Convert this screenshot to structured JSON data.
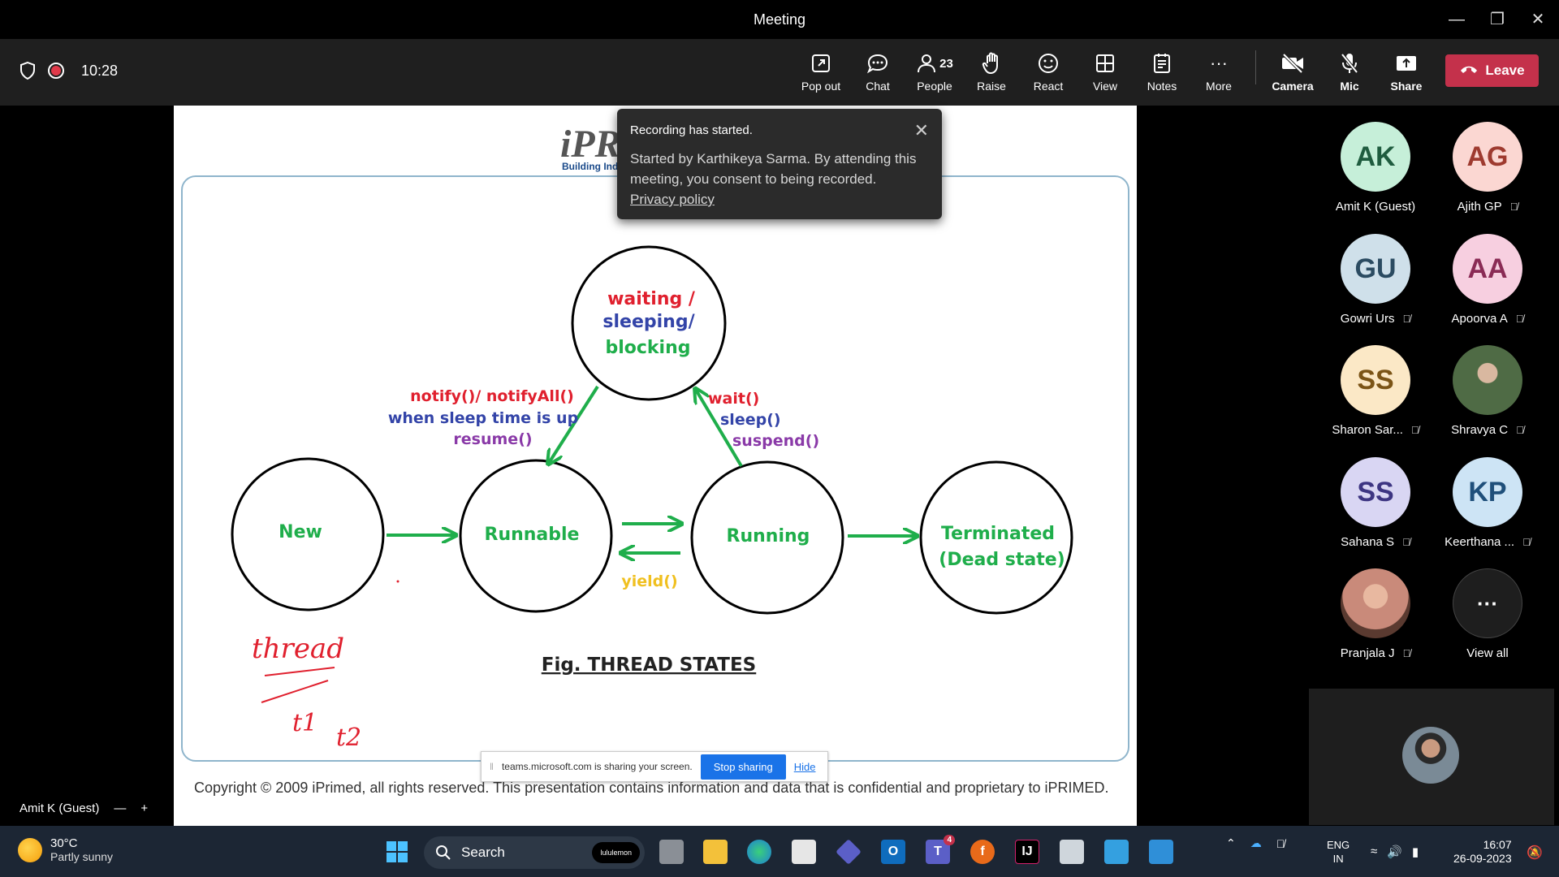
{
  "window": {
    "title": "Meeting"
  },
  "toolbar": {
    "time": "10:28",
    "items": [
      {
        "label": "Pop out",
        "icon": "pop-out-icon"
      },
      {
        "label": "Chat",
        "icon": "chat-icon"
      },
      {
        "label": "People",
        "icon": "people-icon",
        "count": "23"
      },
      {
        "label": "Raise",
        "icon": "hand-icon"
      },
      {
        "label": "React",
        "icon": "smiley-icon"
      },
      {
        "label": "View",
        "icon": "grid-icon"
      },
      {
        "label": "Notes",
        "icon": "notes-icon"
      },
      {
        "label": "More",
        "icon": "more-icon"
      },
      {
        "label": "Camera",
        "icon": "camera-off-icon"
      },
      {
        "label": "Mic",
        "icon": "mic-off-icon"
      },
      {
        "label": "Share",
        "icon": "share-icon"
      }
    ],
    "leave_label": "Leave",
    "leave_color": "#c4314b"
  },
  "slide": {
    "logo": "iPR",
    "logo_sub": "Building Ind",
    "states": {
      "new": "New",
      "runnable": "Runnable",
      "running": "Running",
      "terminated_1": "Terminated",
      "terminated_2": "(Dead state)",
      "waiting_1": "waiting /",
      "waiting_2": "sleeping/",
      "waiting_3": "blocking"
    },
    "labels": {
      "notify": "notify()/ notifyAll()",
      "sleep_up": "when sleep time is up",
      "resume": "resume()",
      "wait": "wait()",
      "sleep": "sleep()",
      "suspend": "suspend()",
      "yield": "yield()"
    },
    "caption": "Fig. THREAD STATES",
    "handwriting": {
      "word": "thread",
      "t1": "t1",
      "t2": "t2"
    },
    "copyright": "Copyright © 2009 iPrimed, all rights reserved. This presentation contains information  and data  that is confidential and proprietary to iPRIMED.",
    "colors": {
      "green": "#1fae4b",
      "red": "#e0202e",
      "blue": "#3344a8",
      "purple": "#8a3aa8",
      "yellow": "#f0c020",
      "ink": "#e0202e"
    }
  },
  "toast": {
    "title": "Recording has started.",
    "body": "Started by Karthikeya Sarma. By attending this meeting, you consent to being recorded.",
    "link": "Privacy policy"
  },
  "sharebar": {
    "text": "teams.microsoft.com is sharing your screen.",
    "stop_label": "Stop sharing",
    "hide_label": "Hide"
  },
  "self": {
    "name": "Amit K (Guest)",
    "minus": "—",
    "plus": "+"
  },
  "participants": [
    {
      "initials": "AK",
      "name": "Amit K (Guest)",
      "bg": "#c6efd9",
      "fg": "#1f5c3f",
      "muted": false
    },
    {
      "initials": "AG",
      "name": "Ajith GP",
      "bg": "#fbd7d2",
      "fg": "#9e3a2f",
      "muted": true
    },
    {
      "initials": "GU",
      "name": "Gowri Urs",
      "bg": "#cfe0ea",
      "fg": "#2b4b61",
      "muted": true
    },
    {
      "initials": "AA",
      "name": "Apoorva A",
      "bg": "#f7cfe0",
      "fg": "#8a2b55",
      "muted": true
    },
    {
      "initials": "SS",
      "name": "Sharon Sar...",
      "bg": "#fbe8c6",
      "fg": "#7b5416",
      "muted": true
    },
    {
      "initials": "",
      "name": "Shravya C",
      "bg": "#6b8a5a",
      "fg": "#ffffff",
      "muted": true,
      "photo": true
    },
    {
      "initials": "SS",
      "name": "Sahana S",
      "bg": "#d9d6f3",
      "fg": "#3d3582",
      "muted": true
    },
    {
      "initials": "KP",
      "name": "Keerthana ...",
      "bg": "#cde4f5",
      "fg": "#1f4f7a",
      "muted": true
    },
    {
      "initials": "",
      "name": "Pranjala J",
      "bg": "#c98a7a",
      "fg": "#ffffff",
      "muted": true,
      "photo": true
    },
    {
      "initials": "···",
      "name": "View all",
      "bg": "#1e1e1e",
      "fg": "#ffffff",
      "muted": false
    }
  ],
  "taskbar": {
    "weather_temp": "30°C",
    "weather_desc": "Partly sunny",
    "search_placeholder": "Search",
    "search_badge": "lululemon",
    "teams_badge": "4",
    "lang_1": "ENG",
    "lang_2": "IN",
    "time": "16:07",
    "date": "26-09-2023"
  }
}
